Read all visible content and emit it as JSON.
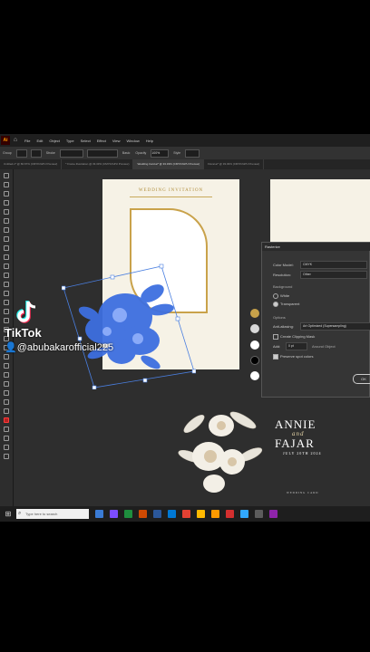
{
  "menu": {
    "app_logo": "Ai",
    "home_icon": "home-icon",
    "items": [
      "File",
      "Edit",
      "Object",
      "Type",
      "Select",
      "Effect",
      "View",
      "Window",
      "Help"
    ]
  },
  "options_bar": {
    "selection_label": "Group",
    "stroke_label": "Stroke",
    "style_label": "Basic",
    "opacity_label": "Opacity",
    "opacity_value": "100%",
    "style2_label": "Style"
  },
  "tabs": [
    "Untitled-1* @ 66.67% (CMYK/GPU Preview)",
    "* Frame illustration @ 33.33% (CMYK/GPU Preview)",
    "Wedding Card.ai* @ 33.33% (CMYK/GPU Preview)",
    "Floral.ai* @ 33.33% (CMYK/GPU Preview)"
  ],
  "artboard": {
    "title": "WEDDING INVITATION"
  },
  "swatches": [
    "#c8a24a",
    "#d8d8d8",
    "#ffffff",
    "#000000",
    "#ffffff"
  ],
  "dialog": {
    "title": "Rasterize",
    "color_model_label": "Color Model:",
    "color_model_value": "CMYK",
    "resolution_label": "Resolution:",
    "resolution_value": "Other",
    "background_label": "Background",
    "bg_white": "White",
    "bg_transparent": "Transparent",
    "options_label": "Options",
    "antialias_label": "Anti-aliasing:",
    "antialias_value": "Art Optimized (Supersampling)",
    "clipping_label": "Create Clipping Mask",
    "add_label": "Add:",
    "add_value": "0 pt",
    "around_label": "Around Object",
    "preserve_label": "Preserve spot colors",
    "ok_label": "OK"
  },
  "preview": {
    "name1": "ANNIE",
    "and": "and",
    "name2": "FAJAR",
    "date": "JULY 20TH 2024",
    "footer": "WEDDING CARD"
  },
  "taskbar": {
    "search_placeholder": "Type here to search"
  },
  "tiktok": {
    "brand": "TikTok",
    "username": "@abubakarofficial225"
  },
  "colors": {
    "accent_gold": "#c9a24a",
    "floral_blue": "#4a7fe0",
    "canvas_bg": "#2e2e2e"
  }
}
